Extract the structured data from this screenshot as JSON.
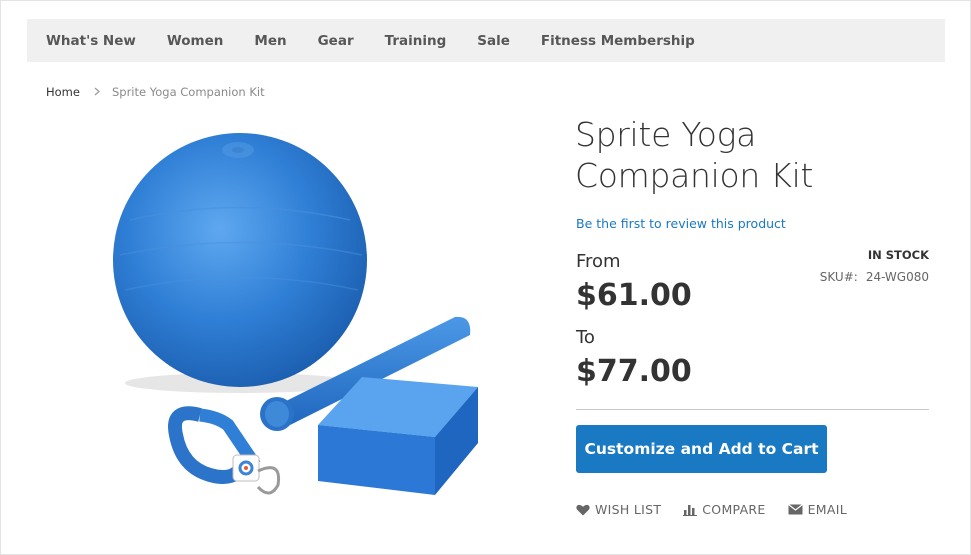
{
  "nav": {
    "items": [
      "What's New",
      "Women",
      "Men",
      "Gear",
      "Training",
      "Sale",
      "Fitness Membership"
    ]
  },
  "breadcrumb": {
    "home": "Home",
    "current": "Sprite Yoga Companion Kit"
  },
  "product": {
    "title": "Sprite Yoga Companion Kit",
    "review_link": "Be the first to review this product",
    "stock_status": "IN STOCK",
    "sku_label": "SKU#:",
    "sku_value": "24-WG080",
    "from_label": "From",
    "from_price": "$61.00",
    "to_label": "To",
    "to_price": "$77.00",
    "image_icon": "yoga-kit-product-image"
  },
  "cart": {
    "button_label": "Customize and Add to Cart"
  },
  "actions": {
    "wishlist": "WISH LIST",
    "compare": "COMPARE",
    "email": "EMAIL"
  },
  "colors": {
    "accent": "#1979c3",
    "nav_bg": "#f0f0f0",
    "product_blue": "#2f7fd6"
  }
}
